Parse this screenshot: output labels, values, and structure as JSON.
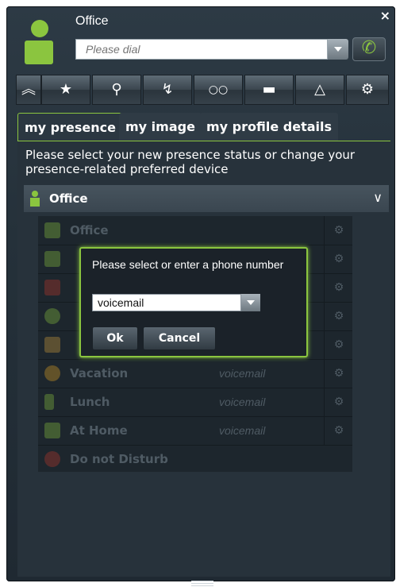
{
  "window": {
    "title": "Office",
    "close_label": "×"
  },
  "dial": {
    "placeholder": "Please dial",
    "call_icon": "phone-icon"
  },
  "toolbar": {
    "icons": [
      "collapse-icon",
      "favorites-icon",
      "search-icon",
      "call-forward-icon",
      "voicemail-icon",
      "chat-icon",
      "network-icon",
      "settings-icon"
    ]
  },
  "tabs": [
    {
      "label": "my presence",
      "active": true
    },
    {
      "label": "my image",
      "active": false
    },
    {
      "label": "my profile details",
      "active": false
    }
  ],
  "presence": {
    "description": "Please select your new presence status or change your presence-related preferred device",
    "current": "Office",
    "list": [
      {
        "label": "Office",
        "device": ""
      },
      {
        "label": "",
        "device": ""
      },
      {
        "label": "",
        "device": ""
      },
      {
        "label": "",
        "device": ""
      },
      {
        "label": "",
        "device": ""
      },
      {
        "label": "Vacation",
        "device": "voicemail"
      },
      {
        "label": "Lunch",
        "device": "voicemail"
      },
      {
        "label": "At Home",
        "device": "voicemail"
      },
      {
        "label": "Do not Disturb",
        "device": ""
      }
    ]
  },
  "dialog": {
    "text": "Please select or enter a phone number",
    "value": "voicemail",
    "ok": "Ok",
    "cancel": "Cancel"
  },
  "colors": {
    "accent": "#8bc53f",
    "background": "#25313a"
  }
}
